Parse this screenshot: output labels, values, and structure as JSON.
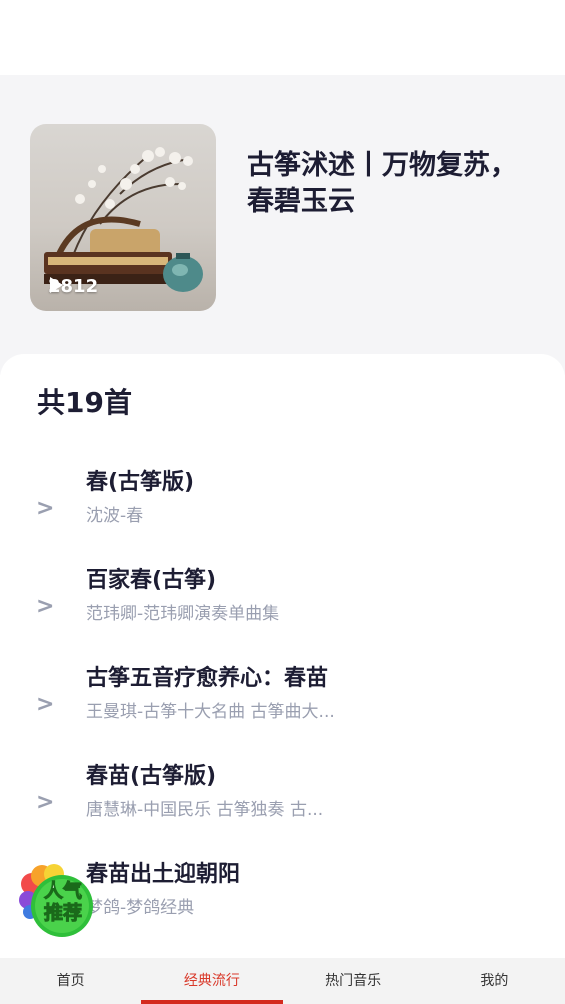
{
  "playlist": {
    "title": "古筝沭述丨万物复苏，春碧玉云",
    "play_count": "2812"
  },
  "list": {
    "count_label": "共19首",
    "songs": [
      {
        "name": "春(古筝版)",
        "sub": "沈波-春"
      },
      {
        "name": "百家春(古筝)",
        "sub": "范玮卿-范玮卿演奏单曲集"
      },
      {
        "name": "古筝五音疗愈养心：春苗",
        "sub": "王曼琪-古筝十大名曲 古筝曲大..."
      },
      {
        "name": "春苗(古筝版)",
        "sub": "唐慧琳-中国民乐 古筝独奏 古..."
      },
      {
        "name": "春苗出土迎朝阳",
        "sub": "梦鸽-梦鸽经典"
      }
    ]
  },
  "badge": {
    "line1": "人气",
    "line2": "推荐"
  },
  "tabbar": {
    "tabs": [
      {
        "label": "首页"
      },
      {
        "label": "经典流行"
      },
      {
        "label": "热门音乐"
      },
      {
        "label": "我的"
      }
    ],
    "active_index": 1
  },
  "colors": {
    "accent": "#d42a1e",
    "header_bg": "#f5f5f7",
    "muted_text": "#9a9fb0"
  }
}
